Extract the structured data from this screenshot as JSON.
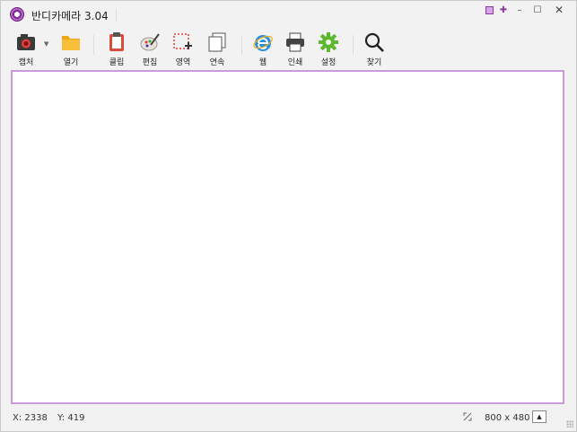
{
  "window": {
    "title": "반디카메라 3.04",
    "controls": {
      "minimize": "–",
      "maximize": "☐",
      "close": "✕"
    }
  },
  "toolbar": {
    "items": [
      {
        "label": "캡처",
        "icon": "camera-icon"
      },
      {
        "label": "열기",
        "icon": "folder-icon"
      },
      {
        "label": "클립",
        "icon": "clipboard-icon"
      },
      {
        "label": "편집",
        "icon": "palette-icon"
      },
      {
        "label": "영역",
        "icon": "region-select-icon"
      },
      {
        "label": "연속",
        "icon": "continuous-icon"
      },
      {
        "label": "웹",
        "icon": "web-icon"
      },
      {
        "label": "인쇄",
        "icon": "printer-icon"
      },
      {
        "label": "설정",
        "icon": "gear-icon"
      },
      {
        "label": "찾기",
        "icon": "search-icon"
      }
    ]
  },
  "status": {
    "x_label": "X: 2338",
    "y_label": "Y: 419",
    "size": "800 x 480",
    "up_arrow": "▲"
  },
  "colors": {
    "accent": "#cc9ad6",
    "brand": "#7a2b8f"
  }
}
